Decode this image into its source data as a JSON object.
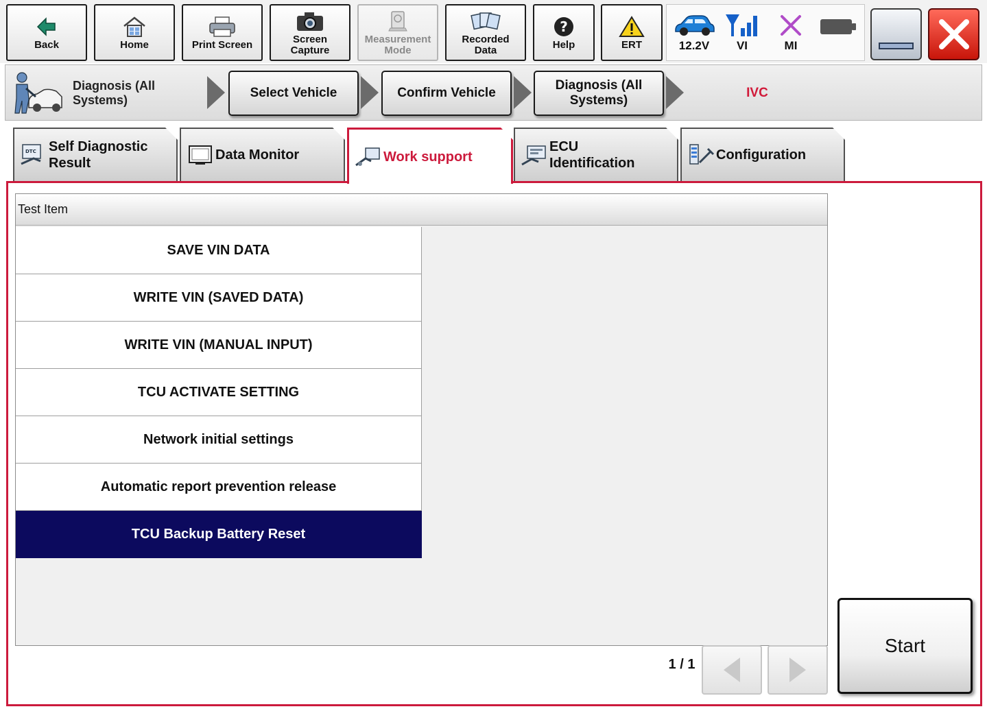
{
  "toolbar": {
    "buttons": [
      {
        "label": "Back",
        "icon": "back-arrow-icon",
        "enabled": true
      },
      {
        "label": "Home",
        "icon": "home-icon",
        "enabled": true
      },
      {
        "label": "Print Screen",
        "icon": "printer-icon",
        "enabled": true
      },
      {
        "label": "Screen\nCapture",
        "icon": "camera-icon",
        "enabled": true
      },
      {
        "label": "Measurement\nMode",
        "icon": "measurement-icon",
        "enabled": false
      },
      {
        "label": "Recorded\nData",
        "icon": "recorded-data-icon",
        "enabled": true
      },
      {
        "label": "Help",
        "icon": "help-icon",
        "enabled": true
      },
      {
        "label": "ERT",
        "icon": "warning-icon",
        "enabled": true
      }
    ],
    "status": {
      "voltage": "12.2V",
      "vi": "VI",
      "mi": "MI"
    }
  },
  "breadcrumb": {
    "first": "Diagnosis (All\nSystems)",
    "steps": [
      "Select Vehicle",
      "Confirm Vehicle",
      "Diagnosis (All\nSystems)"
    ],
    "current": "IVC"
  },
  "tabs": [
    {
      "label": "Self Diagnostic\nResult",
      "active": false
    },
    {
      "label": "Data Monitor",
      "active": false
    },
    {
      "label": "Work support",
      "active": true
    },
    {
      "label": "ECU\nIdentification",
      "active": false
    },
    {
      "label": "Configuration",
      "active": false
    }
  ],
  "list": {
    "header": "Test Item",
    "items": [
      "SAVE VIN DATA",
      "WRITE VIN (SAVED DATA)",
      "WRITE VIN (MANUAL INPUT)",
      "TCU ACTIVATE SETTING",
      "Network initial settings",
      "Automatic report prevention release",
      "TCU Backup Battery Reset"
    ],
    "selected_index": 6
  },
  "pager": {
    "text": "1 / 1"
  },
  "start_label": "Start",
  "colors": {
    "accent": "#cc1a3c",
    "selected_row": "#0c0a5e",
    "voltage_car": "#1e7fd6",
    "vi_signal": "#1560c8",
    "mi_cross": "#b04cc8"
  }
}
